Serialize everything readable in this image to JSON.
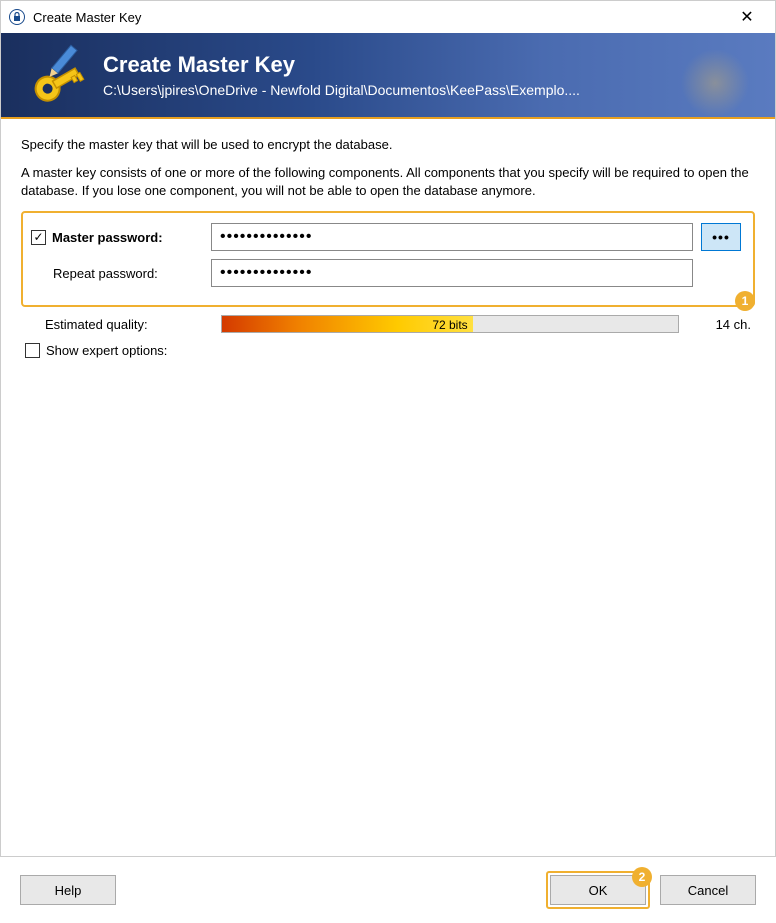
{
  "window": {
    "title": "Create Master Key"
  },
  "banner": {
    "title": "Create Master Key",
    "path": "C:\\Users\\jpires\\OneDrive  -  Newfold  Digital\\Documentos\\KeePass\\Exemplo...."
  },
  "intro": {
    "line1": "Specify the master key that will be used to encrypt the database.",
    "para": "A master key consists of one or more of the following components. All components that you specify will be required to open the database. If you lose one component, you will not be able to open the database anymore."
  },
  "fields": {
    "master_password_label": "Master password:",
    "master_password_value": "••••••••••••••",
    "repeat_password_label": "Repeat password:",
    "repeat_password_value": "••••••••••••••",
    "reveal_label": "•••",
    "quality_label": "Estimated quality:",
    "quality_value": "72 bits",
    "char_count": "14 ch.",
    "expert_label": "Show expert options:"
  },
  "callouts": {
    "one": "1",
    "two": "2"
  },
  "buttons": {
    "help": "Help",
    "ok": "OK",
    "cancel": "Cancel"
  }
}
